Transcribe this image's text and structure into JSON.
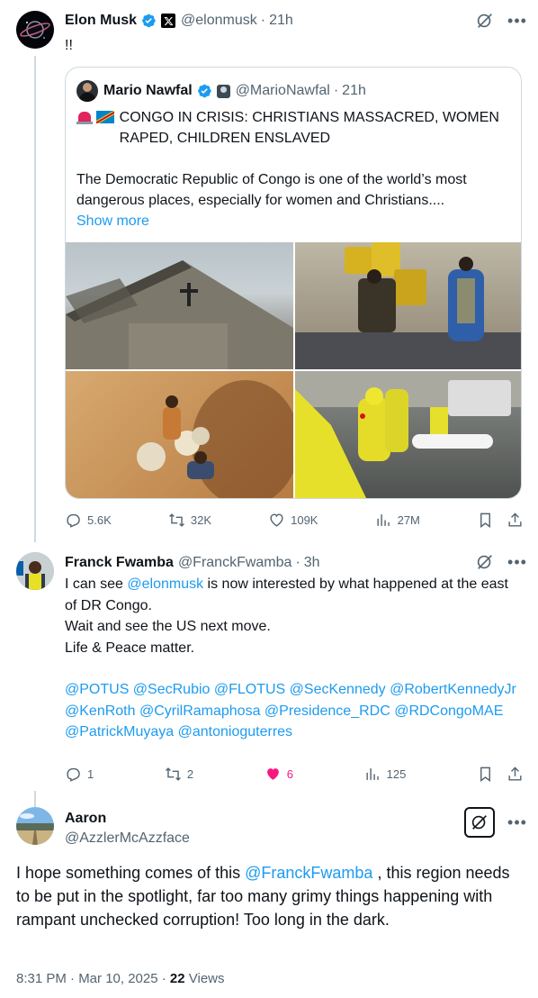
{
  "post1": {
    "author_name": "Elon Musk",
    "handle": "@elonmusk",
    "time": "21h",
    "text": "!!",
    "quote": {
      "author_name": "Mario Nawfal",
      "handle": "@MarioNawfal",
      "time": "21h",
      "headline": "CONGO IN CRISIS: CHRISTIANS MASSACRED, WOMEN RAPED, CHILDREN ENSLAVED",
      "text": "The Democratic Republic of Congo is one of the world’s most dangerous places, especially for women and Christians....",
      "show_more": "Show more"
    },
    "stats": {
      "replies": "5.6K",
      "reposts": "32K",
      "likes": "109K",
      "views": "27M"
    }
  },
  "post2": {
    "author_name": "Franck Fwamba",
    "handle": "@FranckFwamba",
    "time": "3h",
    "text_part1": "I can see ",
    "mention": "@elonmusk",
    "text_part2": " is now interested by what happened at the east of DR Congo.",
    "line2": "Wait and see the US next move.",
    "line3": "Life & Peace matter.",
    "mentions_block": "@POTUS @SecRubio @FLOTUS @SecKennedy @RobertKennedyJr @KenRoth @CyrilRamaphosa @Presidence_RDC @RDCongoMAE @PatrickMuyaya @antonioguterres",
    "stats": {
      "replies": "1",
      "reposts": "2",
      "likes": "6",
      "views": "125"
    }
  },
  "post3": {
    "author_name": "Aaron",
    "handle": "@AzzlerMcAzzface",
    "text_part1": "I hope something comes of this ",
    "mention": "@FranckFwamba",
    "text_part2": " , this region needs to be put in the spotlight, far too many grimy things happening with rampant unchecked corruption! Too long in the dark.",
    "timestamp": "8:31 PM · Mar 10, 2025 · ",
    "views_count": "22",
    "views_label": " Views"
  },
  "colors": {
    "accent": "#1d9bf0",
    "like": "#f91880",
    "muted": "#536471",
    "text": "#0f1419"
  }
}
